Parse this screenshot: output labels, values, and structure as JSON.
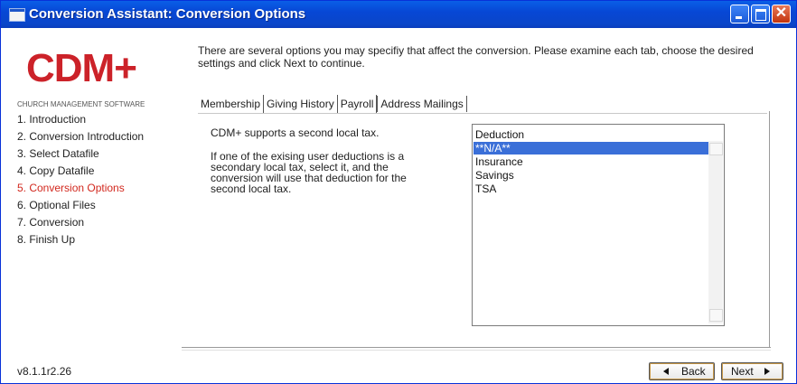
{
  "window": {
    "title": "Conversion Assistant: Conversion Options"
  },
  "logo": {
    "text": "CDM+",
    "tagline": "CHURCH MANAGEMENT SOFTWARE"
  },
  "steps": [
    "1. Introduction",
    "2. Conversion Introduction",
    "3. Select Datafile",
    "4. Copy Datafile",
    "5. Conversion Options",
    "6. Optional Files",
    "7. Conversion",
    "8. Finish Up"
  ],
  "active_step": "5. Conversion Options",
  "intro": "There are several options you may specifiy that affect the conversion. Please examine each tab, choose the desired settings and click Next to continue.",
  "tabs": [
    "Membership",
    "Giving History",
    "Payroll",
    "Address Mailings"
  ],
  "selected_tab": "Payroll",
  "payroll": {
    "line1": "CDM+ supports a second local tax.",
    "line2": "If one of the exising user deductions is a secondary local tax, select it, and the conversion will use that deduction for the second local tax."
  },
  "deduction_list": {
    "header": "Deduction",
    "items": [
      "**N/A**",
      "Insurance",
      "Savings",
      "TSA"
    ],
    "selected": "**N/A**"
  },
  "footer": {
    "version": "v8.1.1r2.26",
    "back_label": "Back",
    "next_label": "Next"
  },
  "colors": {
    "titlebar": "#0747d5",
    "active_step": "#d2281e",
    "selection": "#3a6fd8",
    "logo": "#cc2229"
  }
}
